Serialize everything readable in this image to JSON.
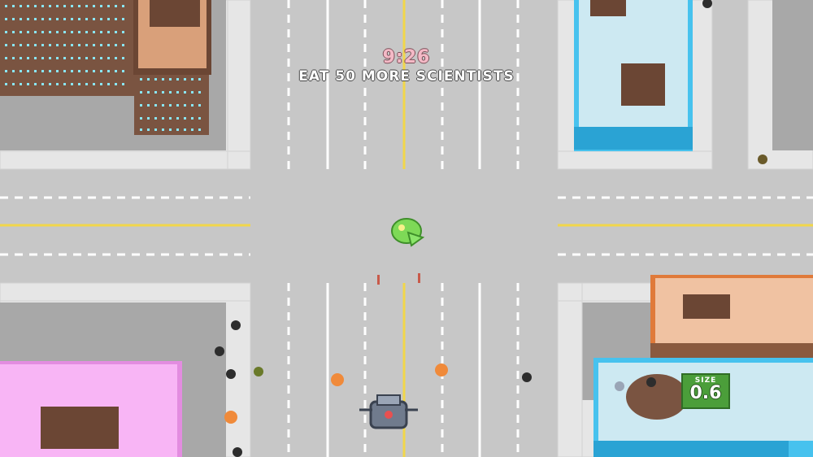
{
  "hud": {
    "timer": "9:26",
    "objective": "EAT 50 MORE SCIENTISTS",
    "size_label": "SIZE",
    "size_value": "0.6"
  },
  "colors": {
    "road": "#c7c7c7",
    "sidewalk": "#e6e6e6",
    "center_line": "#f1d64a",
    "lane_marking": "#ffffff",
    "brown_building": "#7a5441",
    "tan_building": "#d9a07a",
    "cyan_building": "#5fd0f0",
    "orange_building": "#e07a3a",
    "pink_building": "#f5a6f0",
    "player_blob": "#7ed957",
    "size_badge": "#4b9e3a"
  },
  "entities": {
    "player": "green-blob-creature",
    "vehicle": "robot-tank",
    "scientists": "scientist-pedestrian",
    "soldiers": "soldier-pedestrian"
  }
}
